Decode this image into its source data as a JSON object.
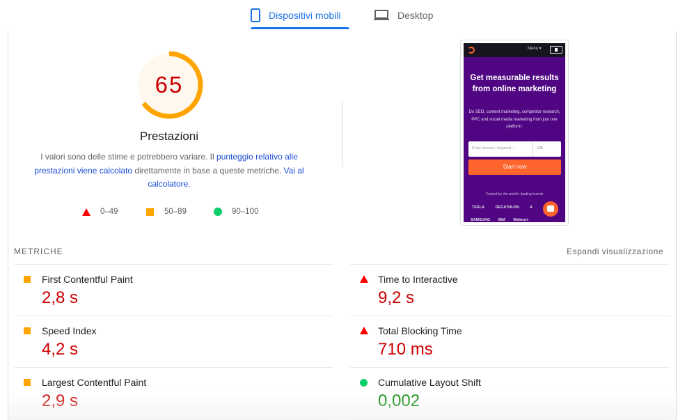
{
  "tabs": [
    {
      "label": "Dispositivi mobili",
      "icon": "smartphone-icon",
      "active": true
    },
    {
      "label": "Desktop",
      "icon": "laptop-icon",
      "active": false
    }
  ],
  "colors": {
    "accent": "#1a73e8",
    "fail": "#ff0000",
    "fail_text": "#cc0000",
    "average": "#ffa400",
    "pass": "#0cce6b",
    "pass_text": "#008800"
  },
  "score": {
    "value": "65",
    "fraction": 0.65,
    "label": "Prestazioni"
  },
  "description": {
    "text1": "I valori sono delle stime e potrebbero variare. Il ",
    "link1": "punteggio relativo alle prestazioni viene calcolato",
    "text2": " direttamente in base a queste metriche. ",
    "link2": "Vai al calcolatore."
  },
  "legend": [
    {
      "icon": "triangle-fail-icon",
      "range": "0–49"
    },
    {
      "icon": "square-average-icon",
      "range": "50–89"
    },
    {
      "icon": "circle-pass-icon",
      "range": "90–100"
    }
  ],
  "screenshot": {
    "nav_menu": "Menu ▾",
    "headline": "Get measurable results from online marketing",
    "subtext": "Do SEO, content marketing, competitor research, PPC and social media marketing from just one platform.",
    "input_placeholder": "Enter domain, keyword ...",
    "country": "US",
    "button": "Start now",
    "trusted": "Trusted by the world's leading brands",
    "brands_row1": [
      "TESLA",
      "DECATHLON",
      "A"
    ],
    "brands_row2": [
      "SAMSUNG",
      "IBM",
      "Walmart"
    ]
  },
  "metrics": {
    "header": "METRICHE",
    "expand_label": "Espandi visualizzazione",
    "items": [
      {
        "title": "First Contentful Paint",
        "value": "2,8 s",
        "status": "average"
      },
      {
        "title": "Time to Interactive",
        "value": "9,2 s",
        "status": "fail"
      },
      {
        "title": "Speed Index",
        "value": "4,2 s",
        "status": "average"
      },
      {
        "title": "Total Blocking Time",
        "value": "710 ms",
        "status": "fail"
      },
      {
        "title": "Largest Contentful Paint",
        "value": "2,9 s",
        "status": "average"
      },
      {
        "title": "Cumulative Layout Shift",
        "value": "0,002",
        "status": "pass"
      }
    ]
  }
}
